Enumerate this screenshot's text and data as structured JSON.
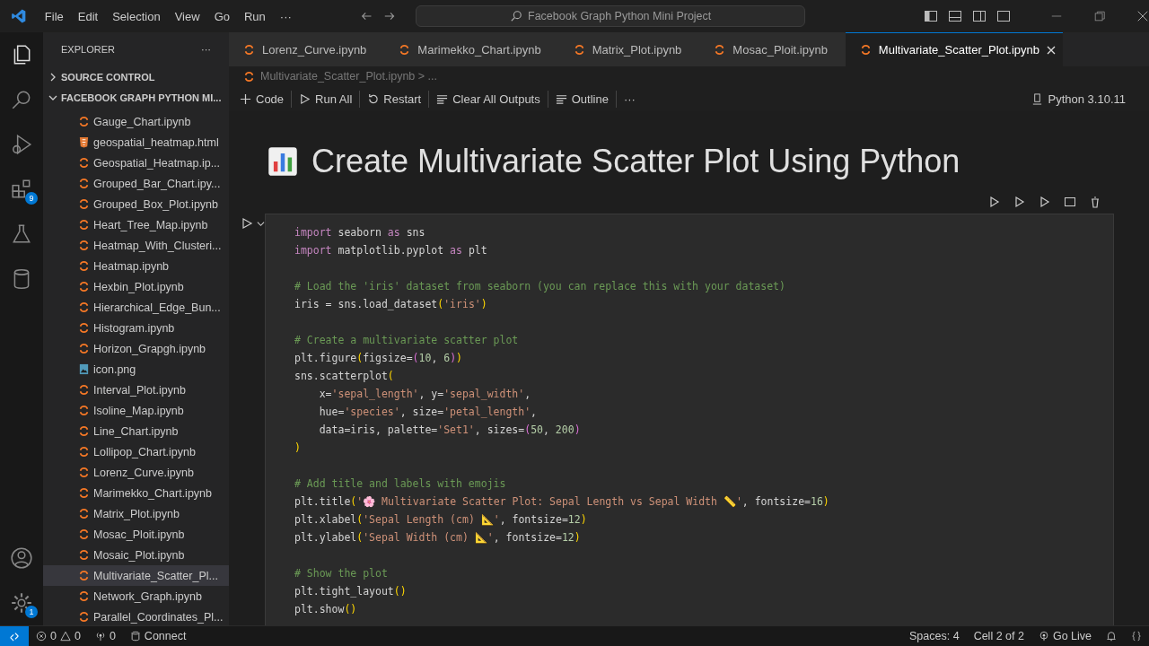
{
  "menu": [
    "File",
    "Edit",
    "Selection",
    "View",
    "Go",
    "Run",
    "···"
  ],
  "command_center": "Facebook Graph Python Mini Project",
  "explorer": {
    "title": "EXPLORER",
    "more": "···",
    "sections": [
      {
        "label": "SOURCE CONTROL",
        "expanded": false
      },
      {
        "label": "FACEBOOK GRAPH PYTHON MI...",
        "expanded": true
      }
    ],
    "files": [
      {
        "name": "Gauge_Chart.ipynb",
        "kind": "notebook",
        "selected": false
      },
      {
        "name": "geospatial_heatmap.html",
        "kind": "html",
        "selected": false
      },
      {
        "name": "Geospatial_Heatmap.ip...",
        "kind": "notebook",
        "selected": false
      },
      {
        "name": "Grouped_Bar_Chart.ipy...",
        "kind": "notebook",
        "selected": false
      },
      {
        "name": "Grouped_Box_Plot.ipynb",
        "kind": "notebook",
        "selected": false
      },
      {
        "name": "Heart_Tree_Map.ipynb",
        "kind": "notebook",
        "selected": false
      },
      {
        "name": "Heatmap_With_Clusteri...",
        "kind": "notebook",
        "selected": false
      },
      {
        "name": "Heatmap.ipynb",
        "kind": "notebook",
        "selected": false
      },
      {
        "name": "Hexbin_Plot.ipynb",
        "kind": "notebook",
        "selected": false
      },
      {
        "name": "Hierarchical_Edge_Bun...",
        "kind": "notebook",
        "selected": false
      },
      {
        "name": "Histogram.ipynb",
        "kind": "notebook",
        "selected": false
      },
      {
        "name": "Horizon_Grapgh.ipynb",
        "kind": "notebook",
        "selected": false
      },
      {
        "name": "icon.png",
        "kind": "image",
        "selected": false
      },
      {
        "name": "Interval_Plot.ipynb",
        "kind": "notebook",
        "selected": false
      },
      {
        "name": "Isoline_Map.ipynb",
        "kind": "notebook",
        "selected": false
      },
      {
        "name": "Line_Chart.ipynb",
        "kind": "notebook",
        "selected": false
      },
      {
        "name": "Lollipop_Chart.ipynb",
        "kind": "notebook",
        "selected": false
      },
      {
        "name": "Lorenz_Curve.ipynb",
        "kind": "notebook",
        "selected": false
      },
      {
        "name": "Marimekko_Chart.ipynb",
        "kind": "notebook",
        "selected": false
      },
      {
        "name": "Matrix_Plot.ipynb",
        "kind": "notebook",
        "selected": false
      },
      {
        "name": "Mosac_Ploit.ipynb",
        "kind": "notebook",
        "selected": false
      },
      {
        "name": "Mosaic_Plot.ipynb",
        "kind": "notebook",
        "selected": false
      },
      {
        "name": "Multivariate_Scatter_Pl...",
        "kind": "notebook",
        "selected": true
      },
      {
        "name": "Network_Graph.ipynb",
        "kind": "notebook",
        "selected": false
      },
      {
        "name": "Parallel_Coordinates_Pl...",
        "kind": "notebook",
        "selected": false
      }
    ]
  },
  "activity_badges": {
    "extensions": "9",
    "settings": "1"
  },
  "tabs": [
    {
      "label": "Lorenz_Curve.ipynb",
      "selected": false
    },
    {
      "label": "Marimekko_Chart.ipynb",
      "selected": false
    },
    {
      "label": "Matrix_Plot.ipynb",
      "selected": false
    },
    {
      "label": "Mosac_Ploit.ipynb",
      "selected": false
    },
    {
      "label": "Multivariate_Scatter_Plot.ipynb",
      "selected": true
    }
  ],
  "breadcrumb": "Multivariate_Scatter_Plot.ipynb > ...",
  "toolbar": [
    "Code",
    "Run All",
    "Restart",
    "Clear All Outputs",
    "Outline"
  ],
  "toolbar_more": "···",
  "kernel": "Python 3.10.11",
  "heading": "Create Multivariate Scatter Plot Using Python",
  "code_blocks": [
    [
      [
        {
          "kind": "kw",
          "text": "import"
        },
        {
          "kind": "plain",
          "text": " seaborn "
        },
        {
          "kind": "kw",
          "text": "as"
        },
        {
          "kind": "plain",
          "text": " sns"
        }
      ],
      [
        {
          "kind": "kw",
          "text": "import"
        },
        {
          "kind": "plain",
          "text": " matplotlib.pyplot "
        },
        {
          "kind": "kw",
          "text": "as"
        },
        {
          "kind": "plain",
          "text": " plt"
        }
      ]
    ],
    [
      [
        {
          "kind": "com",
          "text": "# Load the 'iris' dataset from seaborn (you can replace this with your dataset)"
        }
      ],
      [
        {
          "kind": "plain",
          "text": "iris = sns.load_dataset"
        },
        {
          "kind": "br1",
          "text": "("
        },
        {
          "kind": "str",
          "text": "'iris'"
        },
        {
          "kind": "br1",
          "text": ")"
        }
      ]
    ],
    [
      [
        {
          "kind": "com",
          "text": "# Create a multivariate scatter plot"
        }
      ],
      [
        {
          "kind": "plain",
          "text": "plt.figure"
        },
        {
          "kind": "br1",
          "text": "("
        },
        {
          "kind": "plain",
          "text": "figsize="
        },
        {
          "kind": "br2",
          "text": "("
        },
        {
          "kind": "num",
          "text": "10"
        },
        {
          "kind": "plain",
          "text": ", "
        },
        {
          "kind": "num",
          "text": "6"
        },
        {
          "kind": "br2",
          "text": ")"
        },
        {
          "kind": "br1",
          "text": ")"
        }
      ],
      [
        {
          "kind": "plain",
          "text": "sns.scatterplot"
        },
        {
          "kind": "br1",
          "text": "("
        }
      ],
      [
        {
          "kind": "plain",
          "text": "    x="
        },
        {
          "kind": "str",
          "text": "'sepal_length'"
        },
        {
          "kind": "plain",
          "text": ", y="
        },
        {
          "kind": "str",
          "text": "'sepal_width'"
        },
        {
          "kind": "plain",
          "text": ","
        }
      ],
      [
        {
          "kind": "plain",
          "text": "    hue="
        },
        {
          "kind": "str",
          "text": "'species'"
        },
        {
          "kind": "plain",
          "text": ", size="
        },
        {
          "kind": "str",
          "text": "'petal_length'"
        },
        {
          "kind": "plain",
          "text": ","
        }
      ],
      [
        {
          "kind": "plain",
          "text": "    data=iris, palette="
        },
        {
          "kind": "str",
          "text": "'Set1'"
        },
        {
          "kind": "plain",
          "text": ", sizes="
        },
        {
          "kind": "br2",
          "text": "("
        },
        {
          "kind": "num",
          "text": "50"
        },
        {
          "kind": "plain",
          "text": ", "
        },
        {
          "kind": "num",
          "text": "200"
        },
        {
          "kind": "br2",
          "text": ")"
        }
      ],
      [
        {
          "kind": "br1",
          "text": ")"
        }
      ]
    ],
    [
      [
        {
          "kind": "com",
          "text": "# Add title and labels with emojis"
        }
      ],
      [
        {
          "kind": "plain",
          "text": "plt.title"
        },
        {
          "kind": "br1",
          "text": "("
        },
        {
          "kind": "str",
          "text": "'🌸 Multivariate Scatter Plot: Sepal Length vs Sepal Width 📏'"
        },
        {
          "kind": "plain",
          "text": ", fontsize="
        },
        {
          "kind": "num",
          "text": "16"
        },
        {
          "kind": "br1",
          "text": ")"
        }
      ],
      [
        {
          "kind": "plain",
          "text": "plt.xlabel"
        },
        {
          "kind": "br1",
          "text": "("
        },
        {
          "kind": "str",
          "text": "'Sepal Length (cm) 📐'"
        },
        {
          "kind": "plain",
          "text": ", fontsize="
        },
        {
          "kind": "num",
          "text": "12"
        },
        {
          "kind": "br1",
          "text": ")"
        }
      ],
      [
        {
          "kind": "plain",
          "text": "plt.ylabel"
        },
        {
          "kind": "br1",
          "text": "("
        },
        {
          "kind": "str",
          "text": "'Sepal Width (cm) 📐'"
        },
        {
          "kind": "plain",
          "text": ", fontsize="
        },
        {
          "kind": "num",
          "text": "12"
        },
        {
          "kind": "br1",
          "text": ")"
        }
      ]
    ],
    [
      [
        {
          "kind": "com",
          "text": "# Show the plot"
        }
      ],
      [
        {
          "kind": "plain",
          "text": "plt.tight_layout"
        },
        {
          "kind": "br1",
          "text": "()"
        }
      ],
      [
        {
          "kind": "plain",
          "text": "plt.show"
        },
        {
          "kind": "br1",
          "text": "()"
        }
      ]
    ]
  ],
  "status": {
    "errors": "0",
    "warnings": "0",
    "ports": "0",
    "connect": "Connect",
    "spaces": "Spaces: 4",
    "cell": "Cell 2 of 2",
    "live": "Go Live"
  }
}
